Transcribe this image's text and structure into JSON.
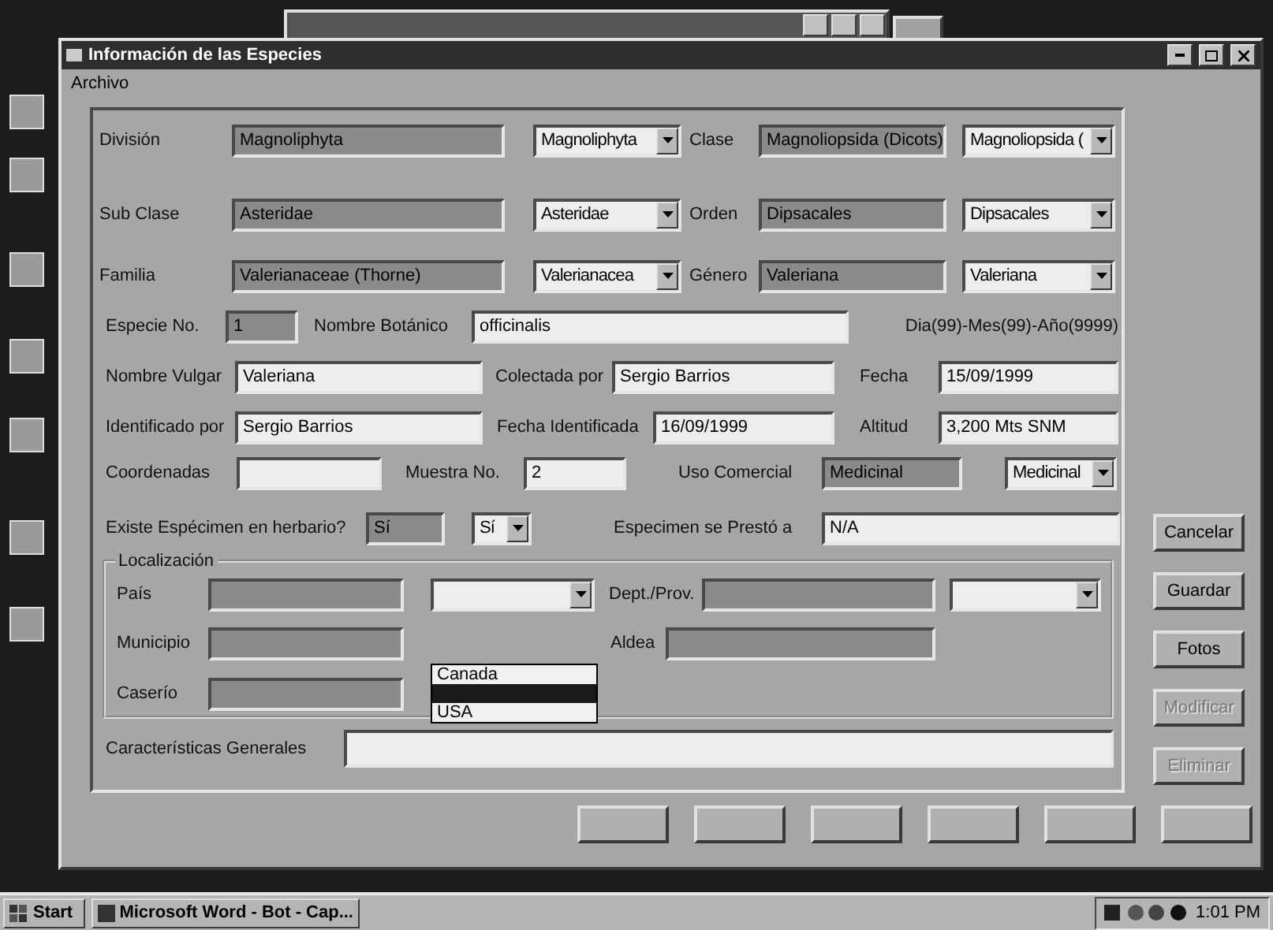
{
  "window": {
    "title": "Información de las Especies",
    "menu": [
      "Archivo"
    ]
  },
  "form_rows": [
    {
      "cells": [
        {
          "kind": "label",
          "text": "División"
        },
        {
          "kind": "field",
          "value": "Magnoliphyta",
          "disabled": true
        },
        {
          "kind": "combo",
          "value": "Magnoliphyta"
        },
        {
          "kind": "label",
          "text": "Clase"
        },
        {
          "kind": "field",
          "value": "Magnoliopsida (Dicots)",
          "disabled": true
        },
        {
          "kind": "combo",
          "value": "Magnoliopsida ("
        }
      ]
    },
    {
      "cells": [
        {
          "kind": "label",
          "text": "Sub Clase"
        },
        {
          "kind": "field",
          "value": "Asteridae",
          "disabled": true
        },
        {
          "kind": "combo",
          "value": "Asteridae"
        },
        {
          "kind": "label",
          "text": "Orden"
        },
        {
          "kind": "field",
          "value": "Dipsacales",
          "disabled": true
        },
        {
          "kind": "combo",
          "value": "Dipsacales"
        }
      ]
    },
    {
      "cells": [
        {
          "kind": "label",
          "text": "Familia"
        },
        {
          "kind": "field",
          "value": "Valerianaceae (Thorne)",
          "disabled": true
        },
        {
          "kind": "combo",
          "value": "Valerianacea"
        },
        {
          "kind": "label",
          "text": "Género"
        },
        {
          "kind": "field",
          "value": "Valeriana",
          "disabled": true
        },
        {
          "kind": "combo",
          "value": "Valeriana"
        }
      ]
    },
    {
      "cells": [
        {
          "kind": "label",
          "text": "Especie No."
        },
        {
          "kind": "field",
          "value": "1",
          "disabled": true
        },
        {
          "kind": "label",
          "text": "Nombre Botánico"
        },
        {
          "kind": "field",
          "value": "officinalis",
          "disabled": false
        },
        {
          "kind": "note",
          "text": "Dia(99)-Mes(99)-Año(9999)"
        }
      ]
    },
    {
      "cells": [
        {
          "kind": "label",
          "text": "Nombre Vulgar"
        },
        {
          "kind": "field",
          "value": "Valeriana",
          "disabled": false
        },
        {
          "kind": "label",
          "text": "Colectada por"
        },
        {
          "kind": "field",
          "value": "Sergio Barrios",
          "disabled": false
        },
        {
          "kind": "label",
          "text": "Fecha"
        },
        {
          "kind": "field",
          "value": "15/09/1999",
          "disabled": false
        }
      ]
    },
    {
      "cells": [
        {
          "kind": "label",
          "text": "Identificado por"
        },
        {
          "kind": "field",
          "value": "Sergio Barrios",
          "disabled": false
        },
        {
          "kind": "label",
          "text": "Fecha Identificada"
        },
        {
          "kind": "field",
          "value": "16/09/1999",
          "disabled": false
        },
        {
          "kind": "label",
          "text": "Altitud"
        },
        {
          "kind": "field",
          "value": "3,200 Mts SNM",
          "disabled": false
        }
      ]
    },
    {
      "cells": [
        {
          "kind": "label",
          "text": "Coordenadas"
        },
        {
          "kind": "field",
          "disabled": false
        },
        {
          "kind": "label",
          "text": "Muestra No."
        },
        {
          "kind": "field",
          "value": "2",
          "disabled": false
        },
        {
          "kind": "label",
          "text": "Uso Comercial"
        },
        {
          "kind": "field",
          "value": "Medicinal",
          "disabled": true
        },
        {
          "kind": "combo",
          "value": "Medicinal"
        }
      ]
    },
    {
      "cells": [
        {
          "kind": "label",
          "text": "Existe Espécimen en herbario?"
        },
        {
          "kind": "field",
          "value": "Sí",
          "disabled": true
        },
        {
          "kind": "combo",
          "value": "Sí"
        },
        {
          "kind": "label",
          "text": "Especimen se Prestó a"
        },
        {
          "kind": "field",
          "value": "N/A",
          "disabled": false
        }
      ]
    }
  ],
  "localizacion": {
    "title": "Localización",
    "rows": [
      {
        "cells": [
          {
            "kind": "label",
            "text": "País"
          },
          {
            "kind": "field",
            "disabled": true
          },
          {
            "kind": "combo"
          },
          {
            "kind": "label",
            "text": "Dept./Prov."
          },
          {
            "kind": "field",
            "disabled": true
          },
          {
            "kind": "combo"
          }
        ]
      },
      {
        "cells": [
          {
            "kind": "label",
            "text": "Municipio"
          },
          {
            "kind": "field",
            "disabled": true
          },
          {
            "kind": "label",
            "text": "Aldea"
          },
          {
            "kind": "field",
            "disabled": true
          }
        ]
      },
      {
        "cells": [
          {
            "kind": "label",
            "text": "Caserío"
          },
          {
            "kind": "field",
            "disabled": true
          }
        ]
      }
    ],
    "dropdown_list": [
      {
        "label": "Canada",
        "selected": false
      },
      {
        "selected": true
      },
      {
        "label": "USA",
        "selected": false
      }
    ]
  },
  "caracteristicas": {
    "label": "Características Generales",
    "disabled": false
  },
  "side_buttons": [
    {
      "label": "Cancelar",
      "disabled": false
    },
    {
      "label": "Guardar",
      "disabled": false
    },
    {
      "label": "Fotos",
      "disabled": false
    },
    {
      "label": "Modificar",
      "disabled": true
    },
    {
      "label": "Eliminar",
      "disabled": true
    }
  ],
  "taskbar": {
    "start": "Start",
    "tasks": [
      "Microsoft Word - Bot - Cap..."
    ],
    "clock": "1:01 PM"
  }
}
